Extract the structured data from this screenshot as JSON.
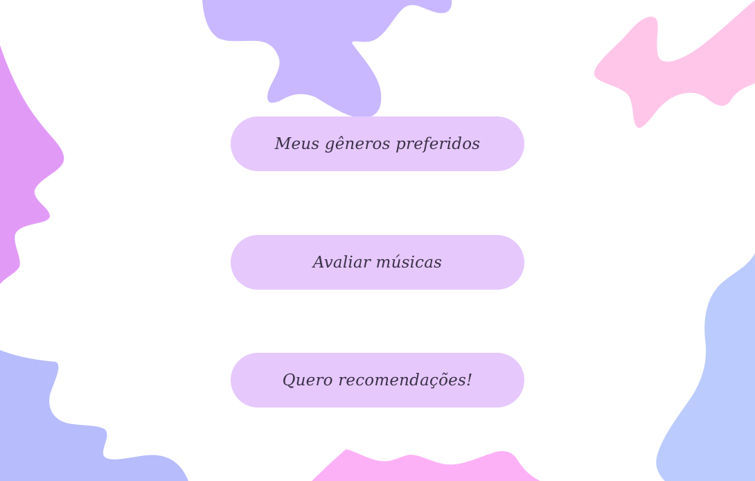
{
  "menu": {
    "buttons": [
      {
        "label": "Meus gêneros preferidos"
      },
      {
        "label": "Avaliar músicas"
      },
      {
        "label": "Quero recomendações!"
      }
    ]
  },
  "colors": {
    "background": "#ffffff",
    "button_fill": "#e6c8fd",
    "button_text": "#3a3147",
    "blob_lavender": "#c9b8ff",
    "blob_pink_light": "#ffc6ea",
    "blob_violet": "#e29af7",
    "blob_periwinkle": "#b7bcfd",
    "blob_blue": "#bccbfd",
    "blob_pink": "#fcb1f6"
  }
}
